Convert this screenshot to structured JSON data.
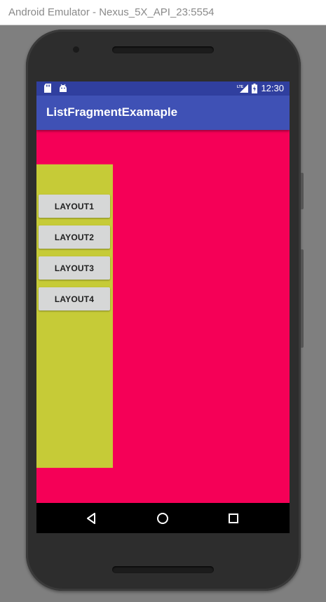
{
  "window": {
    "title": "Android Emulator - Nexus_5X_API_23:5554"
  },
  "status_bar": {
    "time": "12:30",
    "left_icons": [
      "sd-card-icon",
      "android-debug-icon"
    ],
    "right_icons": [
      "lte-signal-icon",
      "battery-charging-icon"
    ],
    "color": "#303f9f"
  },
  "app_bar": {
    "title": "ListFragmentExamaple",
    "color": "#3f51b5"
  },
  "content": {
    "background": "#f50057",
    "fragment_background": "#c6cb37",
    "buttons": [
      {
        "label": "LAYOUT1"
      },
      {
        "label": "LAYOUT2"
      },
      {
        "label": "LAYOUT3"
      },
      {
        "label": "LAYOUT4"
      }
    ]
  },
  "nav_bar": {
    "icons": [
      "back-icon",
      "home-icon",
      "recents-icon"
    ]
  }
}
